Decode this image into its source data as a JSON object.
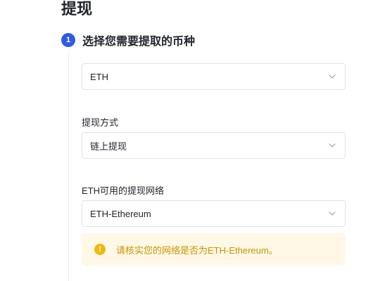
{
  "page": {
    "title": "提现"
  },
  "step": {
    "number": "1",
    "title": "选择您需要提取的币种"
  },
  "fields": {
    "currency": {
      "value": "ETH"
    },
    "method": {
      "label": "提现方式",
      "value": "链上提现"
    },
    "network": {
      "label": "ETH可用的提现网络",
      "value": "ETH-Ethereum"
    }
  },
  "notice": {
    "icon": "exclamation-circle-icon",
    "text": "请核实您的网络是否为ETH-Ethereum。"
  },
  "colors": {
    "accent": "#2f5be3",
    "warning": "#f0b90b",
    "warning_text": "#c99400",
    "warning_bg": "#fff8e6"
  }
}
